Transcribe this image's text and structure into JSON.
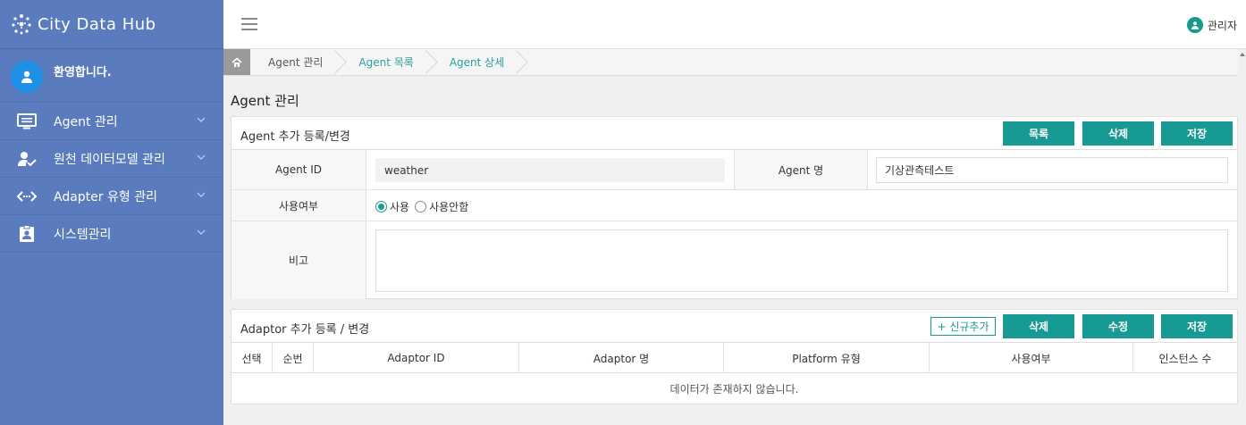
{
  "brand": {
    "name": "City Data Hub"
  },
  "user": {
    "greeting": "환영합니다."
  },
  "sidebar": {
    "items": [
      {
        "label": "Agent 관리",
        "icon": "monitor-icon"
      },
      {
        "label": "원천 데이터모델 관리",
        "icon": "user-check-icon"
      },
      {
        "label": "Adapter 유형 관리",
        "icon": "code-arrows-icon"
      },
      {
        "label": "시스템관리",
        "icon": "id-badge-icon"
      }
    ]
  },
  "header": {
    "admin_label": "관리자"
  },
  "breadcrumb": [
    "Agent 관리",
    "Agent 목록",
    "Agent 상세"
  ],
  "page": {
    "title": "Agent 관리"
  },
  "agent_panel": {
    "title": "Agent 추가 등록/변경",
    "buttons": {
      "list": "목록",
      "delete": "삭제",
      "save": "저장"
    },
    "fields": {
      "agent_id_label": "Agent ID",
      "agent_id_value": "weather",
      "agent_name_label": "Agent 명",
      "agent_name_value": "기상관측테스트",
      "usage_label": "사용여부",
      "usage_on": "사용",
      "usage_off": "사용안함",
      "usage_selected": "사용",
      "note_label": "비고",
      "note_value": ""
    }
  },
  "adaptor_panel": {
    "title": "Adaptor 추가 등록 / 변경",
    "buttons": {
      "add": "+ 신규추가",
      "delete": "삭제",
      "edit": "수정",
      "save": "저장"
    },
    "columns": [
      "선택",
      "순번",
      "Adaptor ID",
      "Adaptor 명",
      "Platform 유형",
      "사용여부",
      "인스턴스 수"
    ],
    "empty_message": "데이터가 존재하지 않습니다."
  },
  "colors": {
    "sidebar": "#5a7bbd",
    "accent": "#189a94",
    "avatar": "#1e90e6"
  }
}
